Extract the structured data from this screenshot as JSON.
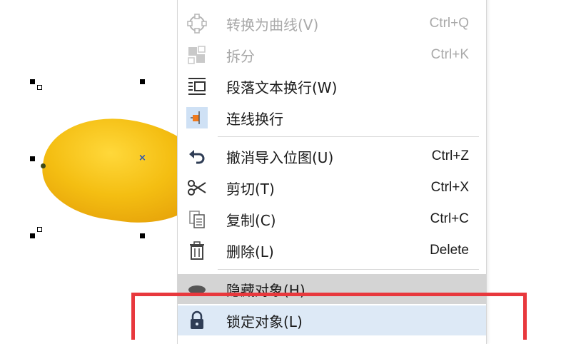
{
  "menu": {
    "items": [
      {
        "label": "转换为曲线(V)",
        "shortcut": "Ctrl+Q",
        "icon": "convert-curve-icon",
        "disabled": true
      },
      {
        "label": "拆分",
        "shortcut": "Ctrl+K",
        "icon": "break-apart-icon",
        "disabled": true
      },
      {
        "label": "段落文本换行(W)",
        "shortcut": "",
        "icon": "paragraph-wrap-icon",
        "disabled": false
      },
      {
        "label": "连线换行",
        "shortcut": "",
        "icon": "line-wrap-icon",
        "disabled": false
      },
      {
        "label": "撤消导入位图(U)",
        "shortcut": "Ctrl+Z",
        "icon": "undo-icon",
        "disabled": false
      },
      {
        "label": "剪切(T)",
        "shortcut": "Ctrl+X",
        "icon": "scissors-icon",
        "disabled": false
      },
      {
        "label": "复制(C)",
        "shortcut": "Ctrl+C",
        "icon": "copy-icon",
        "disabled": false
      },
      {
        "label": "删除(L)",
        "shortcut": "Delete",
        "icon": "trash-icon",
        "disabled": false
      },
      {
        "label": "隐藏对象(H)",
        "shortcut": "",
        "icon": "hide-object-icon",
        "disabled": false
      },
      {
        "label": "锁定对象(L)",
        "shortcut": "",
        "icon": "lock-icon",
        "disabled": false
      }
    ]
  },
  "colors": {
    "highlight_border": "#e8383d",
    "hover_background": "#dde9f6",
    "mango": "#f4be12"
  }
}
